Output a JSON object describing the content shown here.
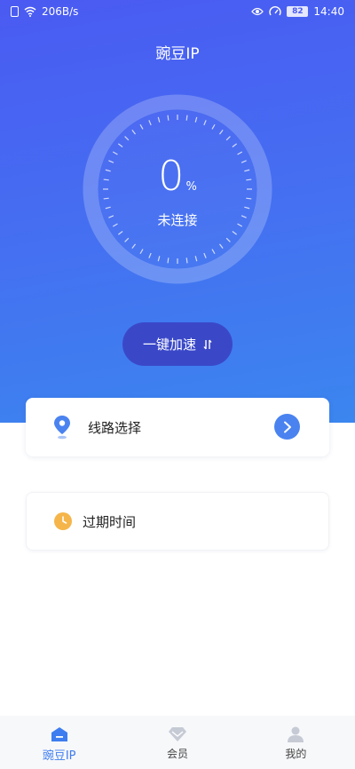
{
  "status_bar": {
    "net_speed": "206B/s",
    "battery": "82",
    "time": "14:40"
  },
  "header": {
    "title": "豌豆IP"
  },
  "dial": {
    "percent_value": "0",
    "percent_unit": "%",
    "connection_status": "未连接",
    "progress": 0
  },
  "boost_button": {
    "label": "一键加速"
  },
  "route_card": {
    "label": "线路选择"
  },
  "expire_card": {
    "label": "过期时间"
  },
  "tabbar": {
    "tabs": [
      {
        "label": "豌豆IP",
        "icon": "home-icon",
        "active": true
      },
      {
        "label": "会员",
        "icon": "diamond-icon",
        "active": false
      },
      {
        "label": "我的",
        "icon": "user-icon",
        "active": false
      }
    ]
  },
  "colors": {
    "brand": "#4a5af2",
    "accent": "#4a83f0",
    "boost_button_bg": "#3a48c8",
    "clock": "#f5b54a"
  }
}
